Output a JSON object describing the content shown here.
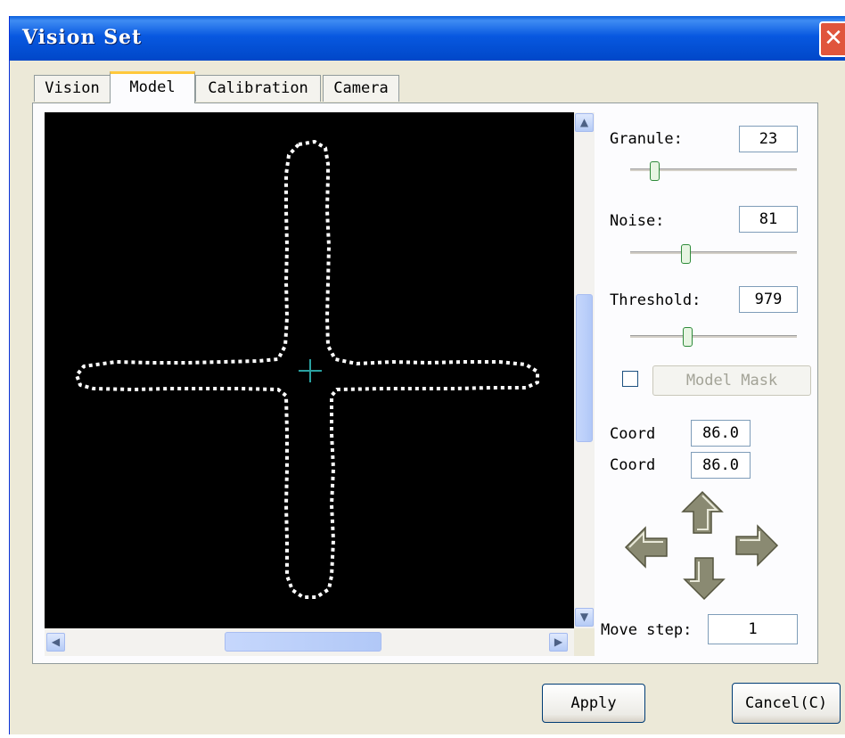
{
  "window": {
    "title": "Vision Set",
    "close_icon": "close-icon"
  },
  "tabs": [
    {
      "label": "Vision",
      "active": false
    },
    {
      "label": "Model",
      "active": true
    },
    {
      "label": "Calibration",
      "active": false
    },
    {
      "label": "Camera",
      "active": false
    }
  ],
  "controls": {
    "granule": {
      "label": "Granule:",
      "value": "23"
    },
    "noise": {
      "label": "Noise:",
      "value": "81"
    },
    "threshold": {
      "label": "Threshold:",
      "value": "979"
    },
    "model_mask": {
      "label": "Model Mask",
      "checked": false
    },
    "coord1": {
      "label": "Coord",
      "value": "86.0"
    },
    "coord2": {
      "label": "Coord",
      "value": "86.0"
    },
    "move_step": {
      "label": "Move step:",
      "value": "1"
    }
  },
  "buttons": {
    "apply": "Apply",
    "cancel": "Cancel(C)"
  },
  "colors": {
    "title_bar": "#0858e0",
    "window_bg": "#ece9d8",
    "model_outline": "#ffffff",
    "crosshair": "#2aa1a1"
  }
}
